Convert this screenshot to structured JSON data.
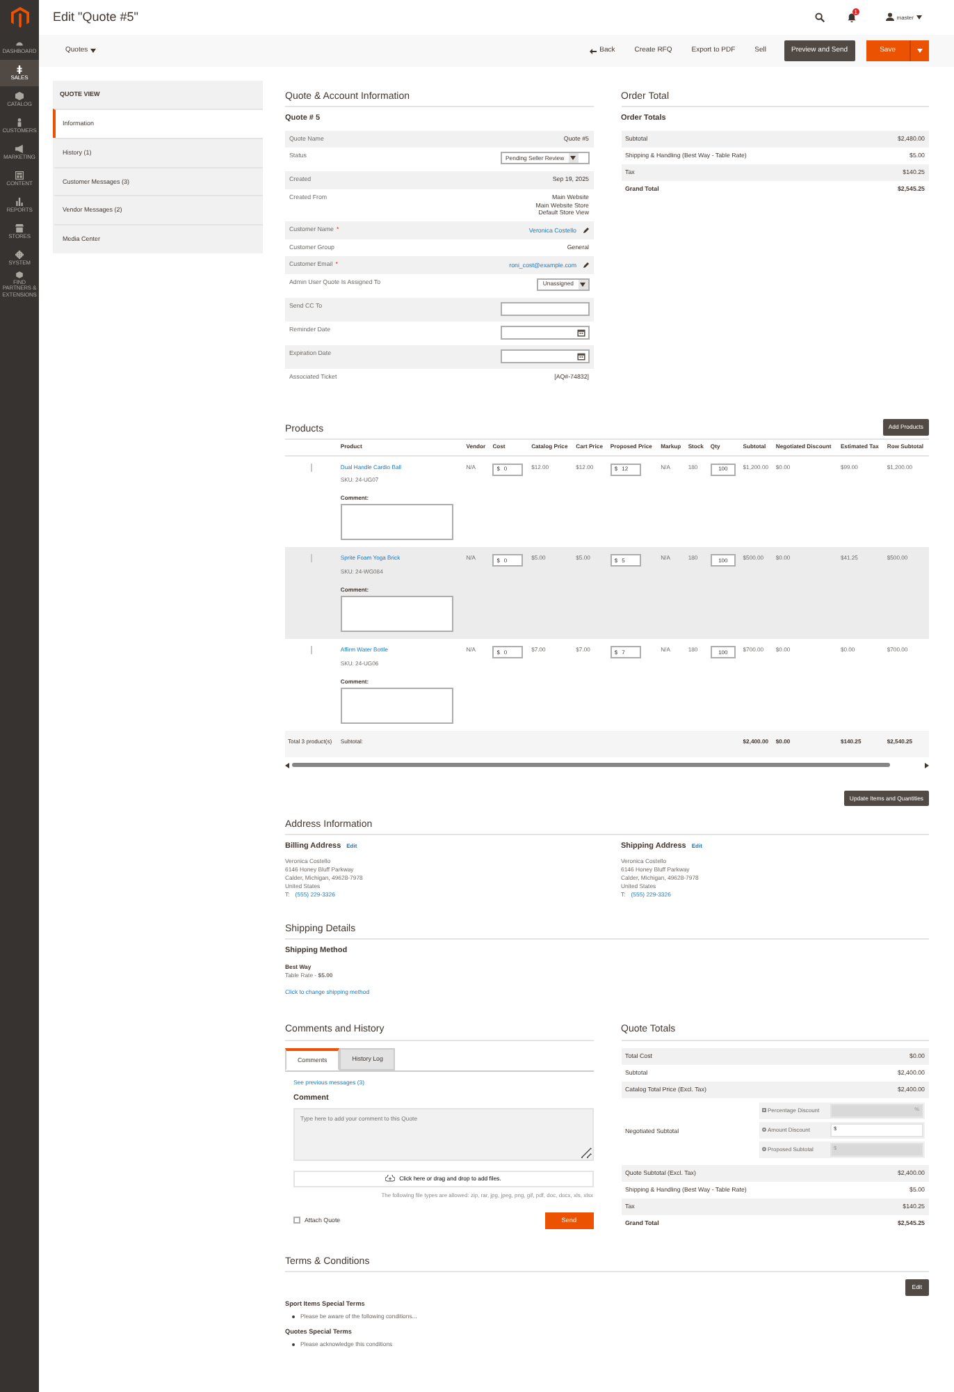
{
  "sidebar": {
    "items": [
      {
        "label": "DASHBOARD",
        "selected": false
      },
      {
        "label": "SALES",
        "selected": true
      },
      {
        "label": "CATALOG",
        "selected": false
      },
      {
        "label": "CUSTOMERS",
        "selected": false
      },
      {
        "label": "MARKETING",
        "selected": false
      },
      {
        "label": "CONTENT",
        "selected": false
      },
      {
        "label": "REPORTS",
        "selected": false
      },
      {
        "label": "STORES",
        "selected": false
      },
      {
        "label": "SYSTEM",
        "selected": false
      },
      {
        "label": "FIND PARTNERS & EXTENSIONS",
        "selected": false
      }
    ]
  },
  "header": {
    "title": "Edit \"Quote #5\"",
    "notifications": "1",
    "user": "master"
  },
  "toolbar": {
    "menu": "Quotes",
    "back": "Back",
    "actions": [
      "Create RFQ",
      "Export to PDF",
      "Sell"
    ],
    "preview": "Preview and Send",
    "save": "Save"
  },
  "quote_view": {
    "title": "QUOTE VIEW",
    "tabs": [
      {
        "label": "Information",
        "selected": true
      },
      {
        "label": "History (1)",
        "selected": false
      },
      {
        "label": "Customer Messages (3)",
        "selected": false
      },
      {
        "label": "Vendor Messages (2)",
        "selected": false
      },
      {
        "label": "Media Center",
        "selected": false
      }
    ]
  },
  "quote_info": {
    "title": "Quote & Account Information",
    "subtitle": "Quote # 5",
    "rows": [
      {
        "kind": "text",
        "label": "Quote Name",
        "value": "Quote #5"
      },
      {
        "kind": "select",
        "label": "Status",
        "value": "Pending Seller Review"
      },
      {
        "kind": "text",
        "label": "Created",
        "value": "Sep 19, 2025"
      },
      {
        "kind": "lines",
        "label": "Created From",
        "lines": [
          "Main Website",
          "Main Website Store",
          "Default Store View"
        ]
      },
      {
        "kind": "link",
        "label": "Customer Name",
        "required_mark": "*",
        "value": "Veronica Costello"
      },
      {
        "kind": "text",
        "label": "Customer Group",
        "value": "General"
      },
      {
        "kind": "link",
        "label": "Customer Email",
        "required_mark": "*",
        "value": "roni_cost@example.com"
      },
      {
        "kind": "select",
        "label": "Admin User Quote Is Assigned To",
        "value": "Unassigned"
      },
      {
        "kind": "input",
        "label": "Send CC To"
      },
      {
        "kind": "date",
        "label": "Reminder Date"
      },
      {
        "kind": "date",
        "label": "Expiration Date"
      },
      {
        "kind": "plainlink",
        "label": "Associated Ticket",
        "value": "[AQ#-74832]"
      }
    ]
  },
  "order_total": {
    "title": "Order Total",
    "subtitle": "Order Totals",
    "rows": [
      {
        "label": "Subtotal",
        "value": "$2,480.00",
        "grand": false
      },
      {
        "label": "Shipping & Handling (Best Way - Table Rate)",
        "value": "$5.00",
        "grand": false
      },
      {
        "label": "Tax",
        "value": "$140.25",
        "grand": false
      },
      {
        "label": "Grand Total",
        "value": "$2,545.25",
        "grand": true
      }
    ]
  },
  "products": {
    "title": "Products",
    "add_button": "Add Products",
    "columns": [
      "Product",
      "Vendor",
      "Cost",
      "Catalog Price",
      "Cart Price",
      "Proposed Price",
      "Markup",
      "Stock",
      "Qty",
      "Subtotal",
      "Negotiated Discount",
      "Estimated Tax",
      "Row Subtotal"
    ],
    "rows": [
      {
        "comment_label": "Comment:",
        "name": "Dual Handle Cardio Ball",
        "sku": "SKU: 24-UG07",
        "vendor": "N/A",
        "cost_prefix": "$",
        "cost": "0",
        "catalog_price": "$12.00",
        "cart_price": "$12.00",
        "proposed_prefix": "$",
        "proposed": "12",
        "markup": "N/A",
        "stock": "180",
        "qty": "100",
        "subtotal": "$1,200.00",
        "discount": "$0.00",
        "tax": "$99.00",
        "row_subtotal": "$1,200.00",
        "selected": false
      },
      {
        "comment_label": "Comment:",
        "name": "Sprite Foam Yoga Brick",
        "sku": "SKU: 24-WG084",
        "vendor": "N/A",
        "cost_prefix": "$",
        "cost": "0",
        "catalog_price": "$5.00",
        "cart_price": "$5.00",
        "proposed_prefix": "$",
        "proposed": "5",
        "markup": "N/A",
        "stock": "180",
        "qty": "100",
        "subtotal": "$500.00",
        "discount": "$0.00",
        "tax": "$41.25",
        "row_subtotal": "$500.00",
        "selected": true
      },
      {
        "comment_label": "Comment:",
        "name": "Affirm Water Bottle",
        "sku": "SKU: 24-UG06",
        "vendor": "N/A",
        "cost_prefix": "$",
        "cost": "0",
        "catalog_price": "$7.00",
        "cart_price": "$7.00",
        "proposed_prefix": "$",
        "proposed": "7",
        "markup": "N/A",
        "stock": "180",
        "qty": "100",
        "subtotal": "$700.00",
        "discount": "$0.00",
        "tax": "$0.00",
        "row_subtotal": "$700.00",
        "selected": false
      }
    ],
    "footer": {
      "count": "Total 3 product(s)",
      "label": "Subtotal:",
      "subtotal": "$2,400.00",
      "discount": "$0.00",
      "tax": "$140.25",
      "row_subtotal": "$2,540.25"
    },
    "update_button": "Update Items and Quantities"
  },
  "address": {
    "title": "Address Information",
    "blocks": [
      {
        "title": "Billing Address",
        "edit": "Edit",
        "lines": [
          "Veronica Costello",
          "6146 Honey Bluff Parkway",
          "Calder, Michigan, 49628-7978",
          "United States"
        ],
        "phone_prefix": "T:",
        "phone": "(555) 229-3326"
      },
      {
        "title": "Shipping Address",
        "edit": "Edit",
        "lines": [
          "Veronica Costello",
          "6146 Honey Bluff Parkway",
          "Calder, Michigan, 49628-7978",
          "United States"
        ],
        "phone_prefix": "T:",
        "phone": "(555) 229-3326"
      }
    ]
  },
  "shipping": {
    "title": "Shipping Details",
    "subtitle": "Shipping Method",
    "method": "Best Way",
    "rate": "Table Rate - **$5.00**",
    "change_link": "Click to change shipping method"
  },
  "comments": {
    "title": "Comments and History",
    "tabs": [
      {
        "label": "Comments",
        "selected": true
      },
      {
        "label": "History Log",
        "selected": false
      }
    ],
    "previous_link": "See previous messages (3)",
    "comment_title": "Comment",
    "placeholder": "Type here to add your comment to this Quote",
    "dropzone": "Click here or drag and drop to add files.",
    "file_note": "The following file types are allowed: zip, rar, jpg, jpeg, png, gif, pdf, doc, docx, xls, xlsx",
    "attach": {
      "label": "Attach Quote",
      "checked": false
    },
    "send": "Send"
  },
  "quote_totals": {
    "title": "Quote Totals",
    "rows": [
      {
        "kind": "row",
        "label": "Total Cost",
        "value": "$0.00"
      },
      {
        "kind": "row",
        "label": "Subtotal",
        "value": "$2,400.00"
      },
      {
        "kind": "row",
        "label": "Catalog Total Price (Excl. Tax)",
        "value": "$2,400.00"
      },
      {
        "kind": "negotiation",
        "label": "Negotiated Subtotal",
        "options": [
          {
            "label": "Percentage Discount",
            "selected": false,
            "disabled": true,
            "suffix": "%"
          },
          {
            "label": "Amount Discount",
            "selected": false,
            "disabled": false,
            "prefix": "$"
          },
          {
            "label": "Proposed Subtotal",
            "selected": false,
            "disabled": true,
            "prefix": "$"
          }
        ]
      },
      {
        "kind": "row",
        "label": "Quote Subtotal (Excl. Tax)",
        "value": "$2,400.00"
      },
      {
        "kind": "row",
        "label": "Shipping & Handling (Best Way - Table Rate)",
        "value": "$5.00"
      },
      {
        "kind": "row",
        "label": "Tax",
        "value": "$140.25"
      },
      {
        "kind": "grand",
        "label": "Grand Total",
        "value": "$2,545.25"
      }
    ]
  },
  "terms": {
    "title": "Terms & Conditions",
    "edit": "Edit",
    "groups": [
      {
        "title": "Sport Items Special Terms",
        "items": [
          "Please be aware of the following conditions..."
        ]
      },
      {
        "title": "Quotes Special Terms",
        "items": [
          "Please acknowledge this conditions"
        ]
      }
    ]
  }
}
